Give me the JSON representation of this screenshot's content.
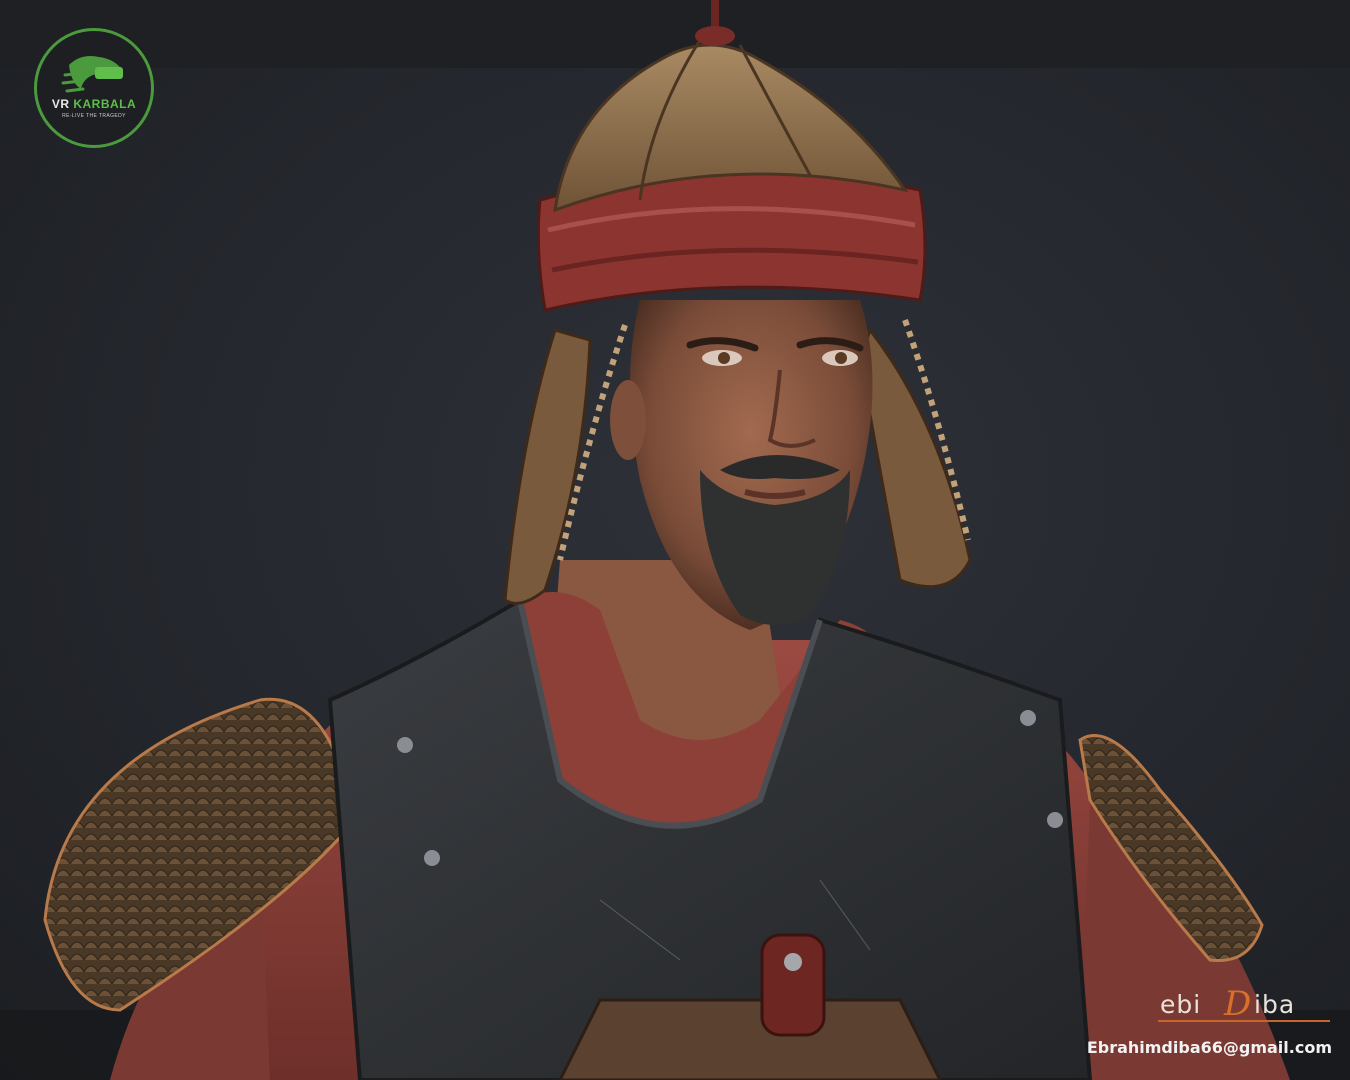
{
  "logo": {
    "name_part1": "VR ",
    "name_part2": "KARBALA",
    "tagline": "RE-LIVE THE TRAGEDY",
    "ring_color": "#4b9a3d",
    "accent_color": "#5fbf4a",
    "icon": "vr-headset-face-icon"
  },
  "render": {
    "subject": "soldier-bust-render"
  },
  "signature": {
    "part1": "ebi",
    "part2": "D",
    "part3": "iba",
    "accent_color": "#d8702a"
  },
  "contact": {
    "email": "Ebrahimdiba66@gmail.com"
  }
}
